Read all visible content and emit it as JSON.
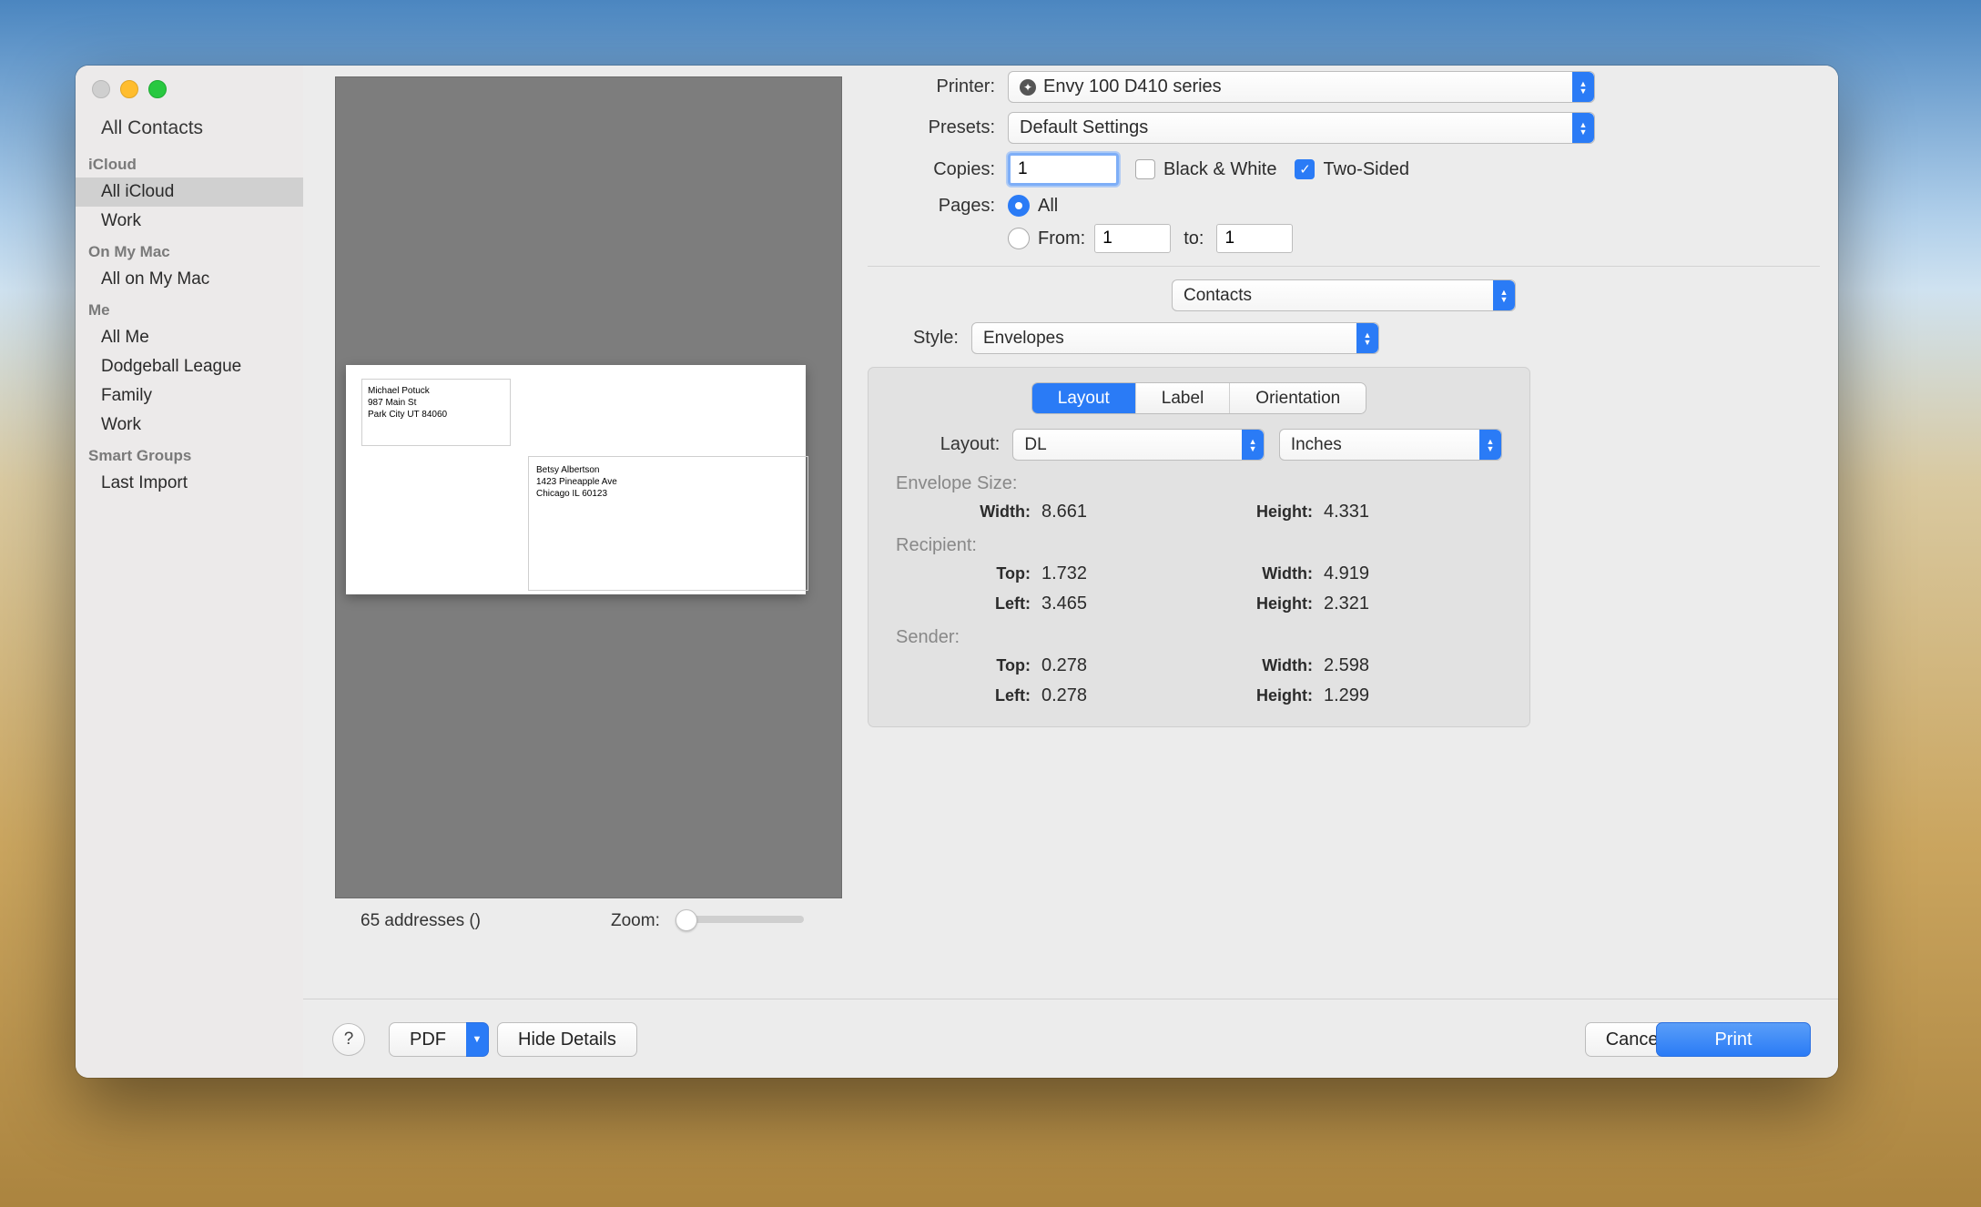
{
  "sidebar": {
    "allContacts": "All Contacts",
    "group1": "iCloud",
    "group1_items": [
      "All iCloud",
      "Work"
    ],
    "group2": "On My Mac",
    "group2_items": [
      "All on My Mac"
    ],
    "group3": "Me",
    "group3_items": [
      "All Me",
      "Dodgeball League",
      "Family",
      "Work"
    ],
    "group4": "Smart Groups",
    "group4_items": [
      "Last Import"
    ]
  },
  "preview": {
    "sender_name": "Michael Potuck",
    "sender_street": "987 Main St",
    "sender_city": "Park City UT 84060",
    "recip_name": "Betsy Albertson",
    "recip_street": "1423 Pineapple Ave",
    "recip_city": "Chicago IL 60123",
    "address_count": "65 addresses ()",
    "zoom_label": "Zoom:"
  },
  "form": {
    "printer_label": "Printer:",
    "printer_value": "Envy 100 D410 series",
    "presets_label": "Presets:",
    "presets_value": "Default Settings",
    "copies_label": "Copies:",
    "copies_value": "1",
    "bw_label": "Black & White",
    "twosided_label": "Two-Sided",
    "pages_label": "Pages:",
    "all_label": "All",
    "from_label": "From:",
    "from_value": "1",
    "to_label": "to:",
    "to_value": "1",
    "app_section": "Contacts",
    "style_label": "Style:",
    "style_value": "Envelopes",
    "tabs": {
      "layout": "Layout",
      "label": "Label",
      "orientation": "Orientation"
    },
    "layout_label": "Layout:",
    "layout_value": "DL",
    "units_value": "Inches",
    "env_size": "Envelope Size:",
    "env_width_k": "Width:",
    "env_width_v": "8.661",
    "env_height_k": "Height:",
    "env_height_v": "4.331",
    "recip": "Recipient:",
    "recip_top_k": "Top:",
    "recip_top_v": "1.732",
    "recip_width_k": "Width:",
    "recip_width_v": "4.919",
    "recip_left_k": "Left:",
    "recip_left_v": "3.465",
    "recip_height_k": "Height:",
    "recip_height_v": "2.321",
    "sender": "Sender:",
    "sender_top_k": "Top:",
    "sender_top_v": "0.278",
    "sender_width_k": "Width:",
    "sender_width_v": "2.598",
    "sender_left_k": "Left:",
    "sender_left_v": "0.278",
    "sender_height_k": "Height:",
    "sender_height_v": "1.299"
  },
  "footer": {
    "help": "?",
    "pdf": "PDF",
    "hide_details": "Hide Details",
    "cancel": "Cancel",
    "print": "Print"
  }
}
